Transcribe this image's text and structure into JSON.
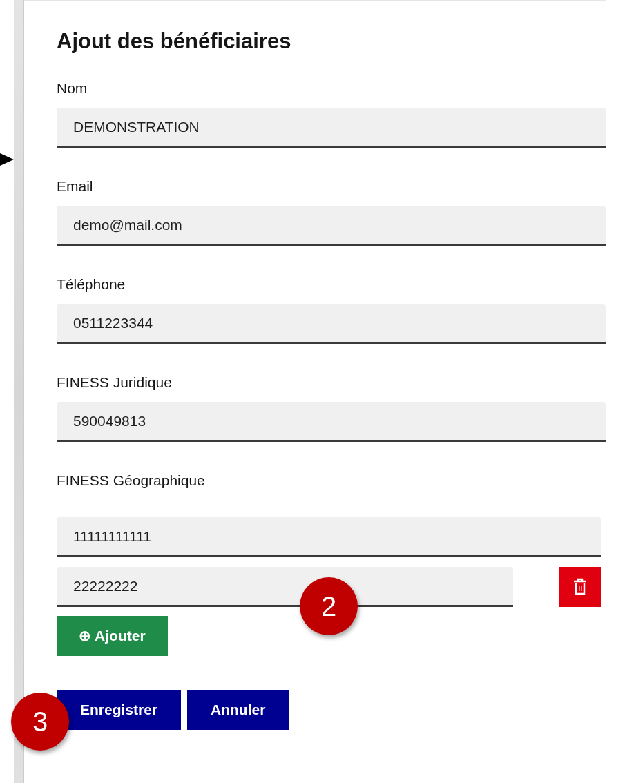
{
  "title": "Ajout des bénéficiaires",
  "fields": [
    {
      "label": "Nom",
      "value": "DEMONSTRATION"
    },
    {
      "label": "Email",
      "value": "demo@mail.com"
    },
    {
      "label": "Téléphone",
      "value": "0511223344"
    },
    {
      "label": "FINESS Juridique",
      "value": "590049813"
    }
  ],
  "geo": {
    "label": "FINESS Géographique",
    "entries": [
      {
        "value": "11111111111",
        "removable": false
      },
      {
        "value": "22222222",
        "removable": true
      }
    ],
    "add_button": "⊕ Ajouter"
  },
  "buttons": [
    {
      "label": "Enregistrer"
    },
    {
      "label": "Annuler"
    }
  ],
  "annotations": [
    {
      "label": "2"
    },
    {
      "label": "3"
    }
  ]
}
